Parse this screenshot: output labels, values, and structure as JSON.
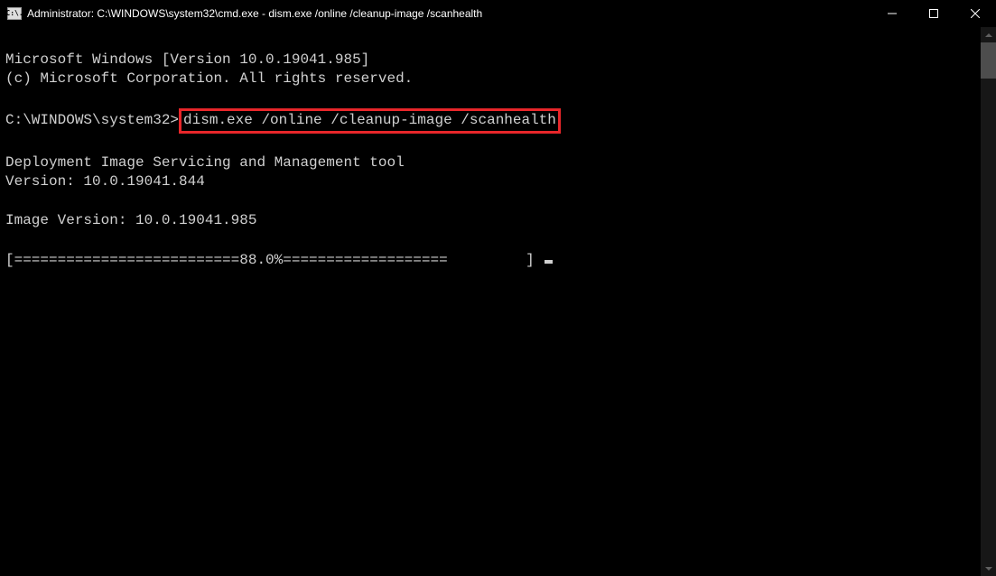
{
  "window": {
    "title": "Administrator: C:\\WINDOWS\\system32\\cmd.exe - dism.exe  /online /cleanup-image /scanhealth",
    "icon_label": "C:\\."
  },
  "terminal": {
    "line1": "Microsoft Windows [Version 10.0.19041.985]",
    "line2": "(c) Microsoft Corporation. All rights reserved.",
    "blank1": "",
    "prompt_prefix": "C:\\WINDOWS\\system32>",
    "command": "dism.exe /online /cleanup-image /scanhealth",
    "blank2": "",
    "line3": "Deployment Image Servicing and Management tool",
    "line4": "Version: 10.0.19041.844",
    "blank3": "",
    "line5": "Image Version: 10.0.19041.985",
    "blank4": "",
    "progress": "[==========================88.0%===================         ] "
  }
}
